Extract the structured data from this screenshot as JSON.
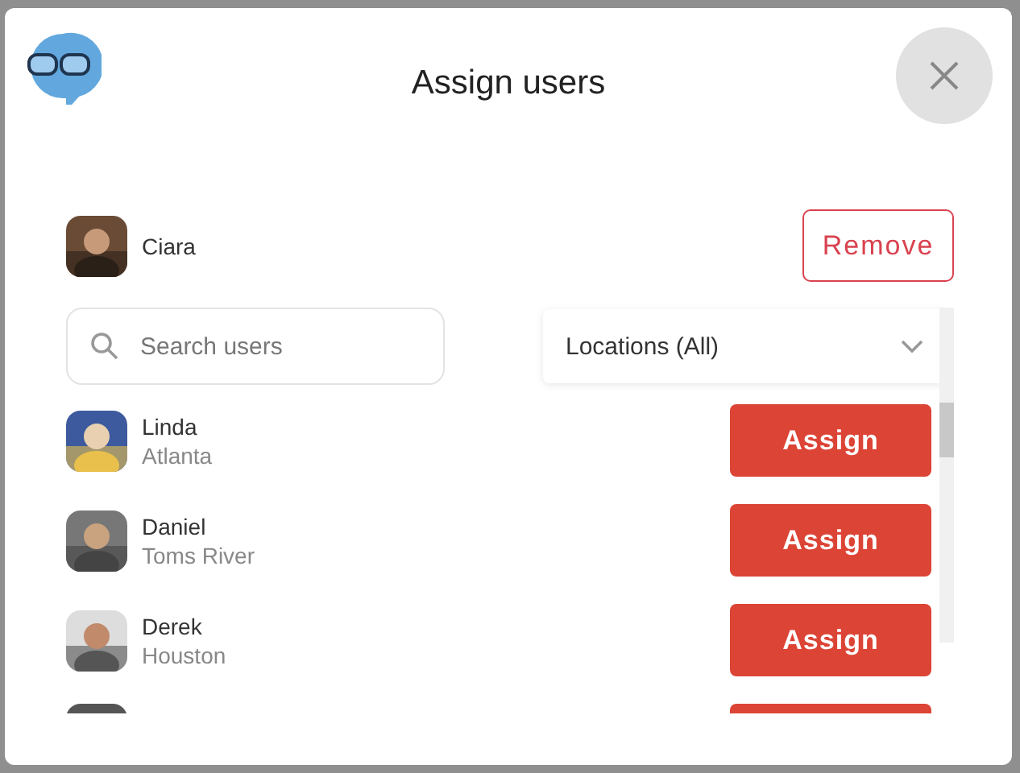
{
  "dialog": {
    "title": "Assign users"
  },
  "assigned": [
    {
      "name": "Ciara",
      "action": "Remove"
    }
  ],
  "search": {
    "placeholder": "Search users"
  },
  "filter": {
    "value": "Locations (All)"
  },
  "users": [
    {
      "kind": "user",
      "name": "Linda",
      "location": "Atlanta",
      "action": "Assign"
    },
    {
      "kind": "user",
      "name": "Daniel",
      "location": "Toms River",
      "action": "Assign"
    },
    {
      "kind": "user",
      "name": "Derek",
      "location": "Houston",
      "action": "Assign"
    },
    {
      "kind": "partial"
    }
  ]
}
